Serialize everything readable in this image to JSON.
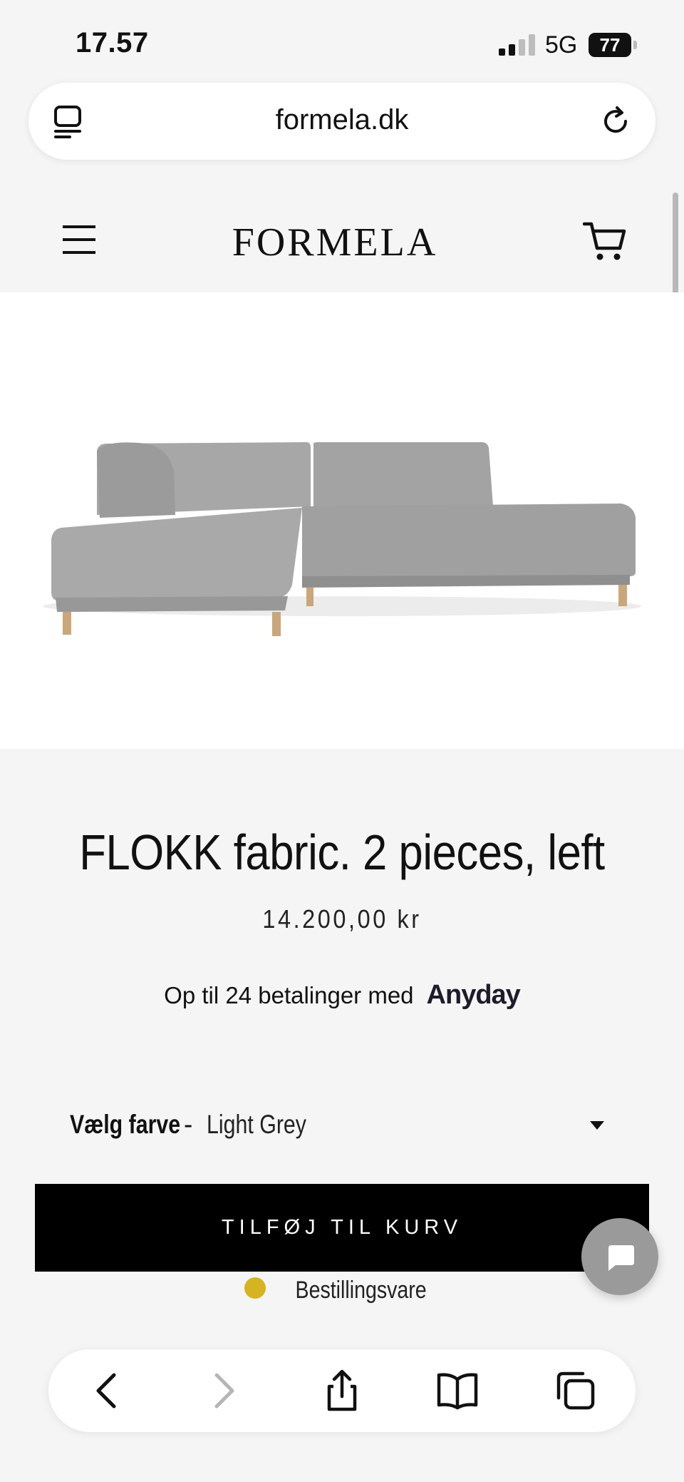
{
  "status_bar": {
    "time": "17.57",
    "network": "5G",
    "battery": "77"
  },
  "browser": {
    "url": "formela.dk"
  },
  "site": {
    "logo": "FORMELA"
  },
  "product": {
    "title": "FLOKK fabric. 2 pieces, left",
    "price": "14.200,00 kr",
    "financing_text": "Op til 24 betalinger med",
    "financing_brand": "Anyday",
    "color_label": "Vælg farve",
    "color_separator": "-",
    "color_value": "Light Grey",
    "add_to_cart": "TILFØJ TIL KURV",
    "stock_status": "Bestillingsvare",
    "stock_color": "#d6b421"
  },
  "icons": {
    "menu": "hamburger-menu-icon",
    "cart": "shopping-cart-icon",
    "chat": "chat-bubble-icon",
    "back": "chevron-left-icon",
    "forward": "chevron-right-icon",
    "share": "share-icon",
    "bookmarks": "open-book-icon",
    "tabs": "tabs-icon"
  }
}
